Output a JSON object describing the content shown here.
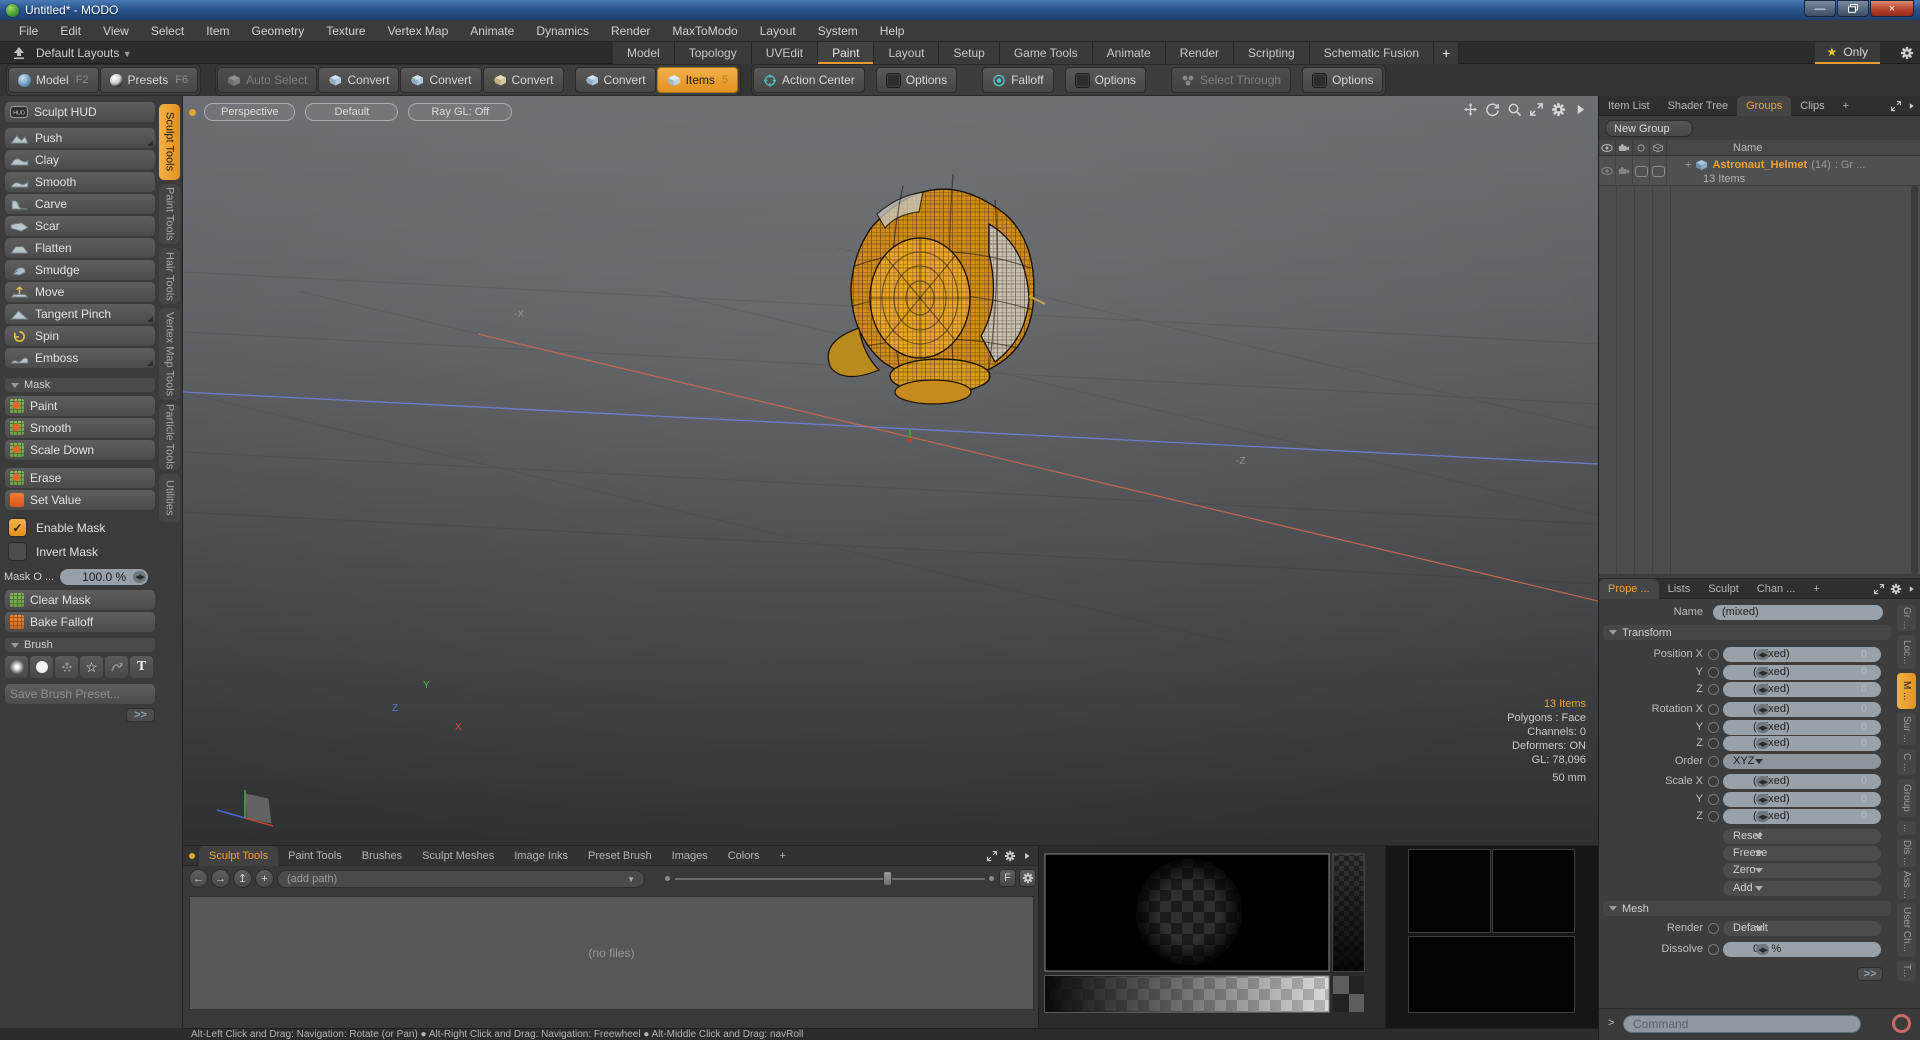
{
  "window": {
    "title": "Untitled* - MODO"
  },
  "menu": {
    "items": [
      "File",
      "Edit",
      "View",
      "Select",
      "Item",
      "Geometry",
      "Texture",
      "Vertex Map",
      "Animate",
      "Dynamics",
      "Render",
      "MaxToModo",
      "Layout",
      "System",
      "Help"
    ]
  },
  "layout_bar": {
    "layouts_label": "Default Layouts",
    "tabs": [
      "Model",
      "Topology",
      "UVEdit",
      "Paint",
      "Layout",
      "Setup",
      "Game Tools",
      "Animate",
      "Render",
      "Scripting",
      "Schematic Fusion"
    ],
    "add_tab": "+",
    "star": "★",
    "only_label": "Only"
  },
  "toolbar": {
    "model_label": "Model",
    "model_key": "F2",
    "presets_label": "Presets",
    "presets_key": "F6",
    "auto_select": "Auto Select",
    "convert": "Convert",
    "items_label": "Items",
    "items_key": "5",
    "action_center": "Action Center",
    "options": "Options",
    "falloff": "Falloff",
    "select_through": "Select Through"
  },
  "sidebar": {
    "hud_label": "Sculpt HUD",
    "tools": [
      "Push",
      "Clay",
      "Smooth",
      "Carve",
      "Scar",
      "Flatten",
      "Smudge",
      "Move",
      "Tangent Pinch",
      "Spin",
      "Emboss"
    ],
    "mask_header": "Mask",
    "mask_tools": [
      "Paint",
      "Smooth",
      "Scale Down"
    ],
    "mask_tools2": [
      "Erase",
      "Set Value"
    ],
    "enable_mask": "Enable Mask",
    "invert_mask": "Invert Mask",
    "mask_opacity_label": "Mask O ...",
    "mask_opacity_value": "100.0 %",
    "clear_mask": "Clear Mask",
    "bake_falloff": "Bake Falloff",
    "brush_header": "Brush",
    "brush_text_tool": "T",
    "brush_star_tool": "☆",
    "save_brush_label": "Save Brush Preset...",
    "more_label": ">>",
    "vtabs": [
      "Sculpt Tools",
      "Paint Tools",
      "Hair Tools",
      "Vertex Map Tools",
      "Particle Tools",
      "Utilities"
    ]
  },
  "viewport": {
    "camera_label": "Perspective",
    "shading_label": "Default",
    "raygl_label": "Ray GL: Off",
    "axis_neg_x": "-X",
    "axis_neg_z": "-Z",
    "gizmo_x": "X",
    "gizmo_y": "Y",
    "gizmo_z": "Z",
    "info_items": "13 Items",
    "info_polygons": "Polygons : Face",
    "info_channels": "Channels: 0",
    "info_deformers": "Deformers: ON",
    "info_gl": "GL: 78,096",
    "info_focal": "50 mm"
  },
  "bottom_panel": {
    "tabs": [
      "Sculpt Tools",
      "Paint Tools",
      "Brushes",
      "Sculpt Meshes",
      "Image Inks",
      "Preset Brush",
      "Images",
      "Colors"
    ],
    "add_tab": "+",
    "path_placeholder": "(add path)",
    "f_label": "F",
    "no_files": "(no files)"
  },
  "right_panel": {
    "tabs": [
      "Item List",
      "Shader Tree",
      "Groups",
      "Clips"
    ],
    "add_tab": "+",
    "new_group_label": "New Group",
    "name_column": "Name",
    "group_name": "Astronaut_Helmet",
    "group_count": "(14)",
    "group_suffix": ": Gr ...",
    "group_items": "13 Items"
  },
  "properties": {
    "tabs": [
      "Prope ...",
      "Lists",
      "Sculpt",
      "Chan ..."
    ],
    "add_tab": "+",
    "name_label": "Name",
    "name_value": "(mixed)",
    "transform_header": "Transform",
    "labels": {
      "position_x": "Position X",
      "y": "Y",
      "z": "Z",
      "rotation_x": "Rotation X",
      "order": "Order",
      "scale_x": "Scale X"
    },
    "mixed": "(mixed)",
    "order_value": "XYZ",
    "buttons": [
      "Reset",
      "Freeze",
      "Zero",
      "Add"
    ],
    "mesh_header": "Mesh",
    "render_label": "Render",
    "render_value": "Default",
    "dissolve_label": "Dissolve",
    "dissolve_value": "0.0 %",
    "more_label": ">>",
    "vtabs": [
      "Gr ...",
      "Loc...",
      "M ...",
      "Sur ...",
      "C ...",
      "Group",
      "...",
      "Dis ...",
      "Ass ...",
      "User Ch...",
      "T..."
    ]
  },
  "command": {
    "prompt": ">",
    "placeholder": "Command"
  },
  "status": {
    "text": "Alt-Left Click and Drag: Navigation: Rotate (or Pan)   ●   Alt-Right Click and Drag: Navigation: Freewheel   ●   Alt-Middle Click and Drag: navRoll"
  },
  "colors": {
    "accent": "#ee9e3c",
    "field": "#97a1a7",
    "axis_blue": "#6b7ce0",
    "axis_red": "#cf6a55"
  }
}
